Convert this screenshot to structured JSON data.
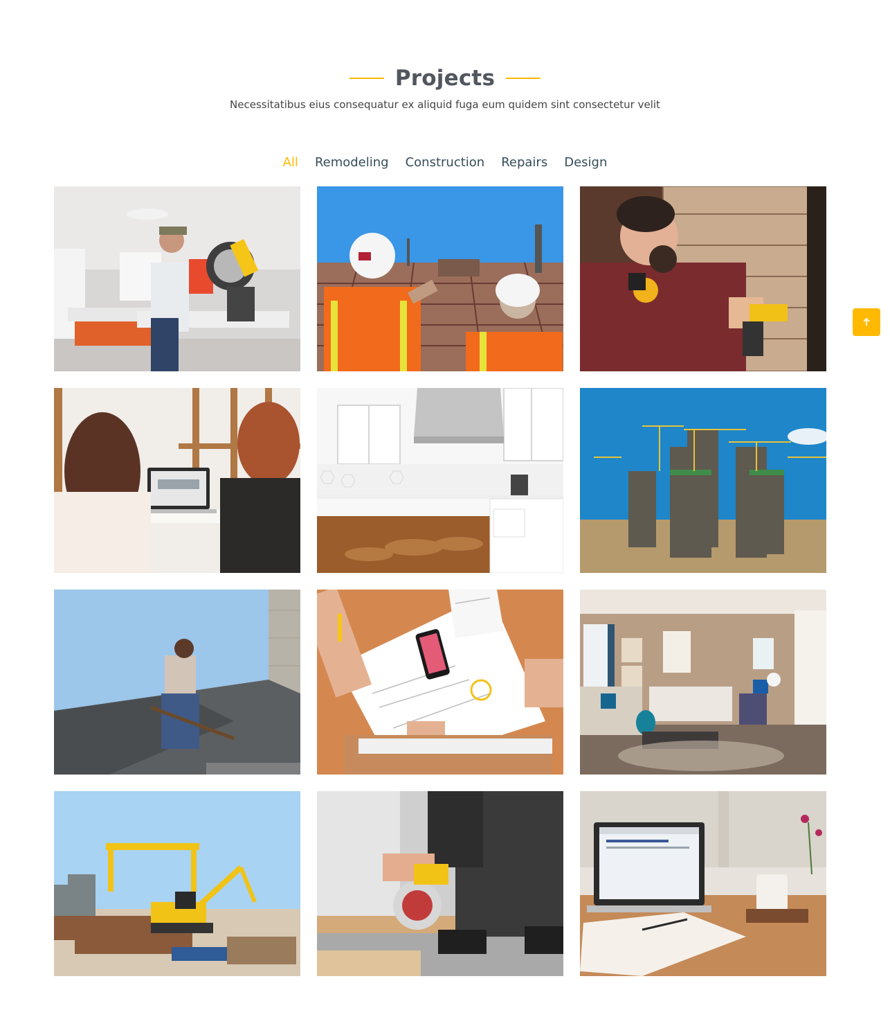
{
  "section": {
    "title": "Projects",
    "subtitle": "Necessitatibus eius consequatur ex aliquid fuga eum quidem sint consectetur velit"
  },
  "filters": [
    {
      "label": "All",
      "active": true
    },
    {
      "label": "Remodeling",
      "active": false
    },
    {
      "label": "Construction",
      "active": false
    },
    {
      "label": "Repairs",
      "active": false
    },
    {
      "label": "Design",
      "active": false
    }
  ],
  "projects": [
    {
      "subject": "workers-using-miter-saw"
    },
    {
      "subject": "engineers-at-construction-site"
    },
    {
      "subject": "man-drilling-log-wall"
    },
    {
      "subject": "women-reviewing-laptop"
    },
    {
      "subject": "white-kitchen-interior"
    },
    {
      "subject": "high-rise-towers-under-construction"
    },
    {
      "subject": "roofer-on-roof"
    },
    {
      "subject": "hands-sketching-plans-desk"
    },
    {
      "subject": "modern-living-room"
    },
    {
      "subject": "yellow-excavator-lumber-yard"
    },
    {
      "subject": "man-cutting-with-circular-saw"
    },
    {
      "subject": "laptop-and-notebook-on-table"
    }
  ],
  "colors": {
    "accent": "#feb900",
    "heading": "#52565e",
    "text": "#364d59"
  },
  "back_to_top": {
    "icon": "arrow-up-icon"
  }
}
